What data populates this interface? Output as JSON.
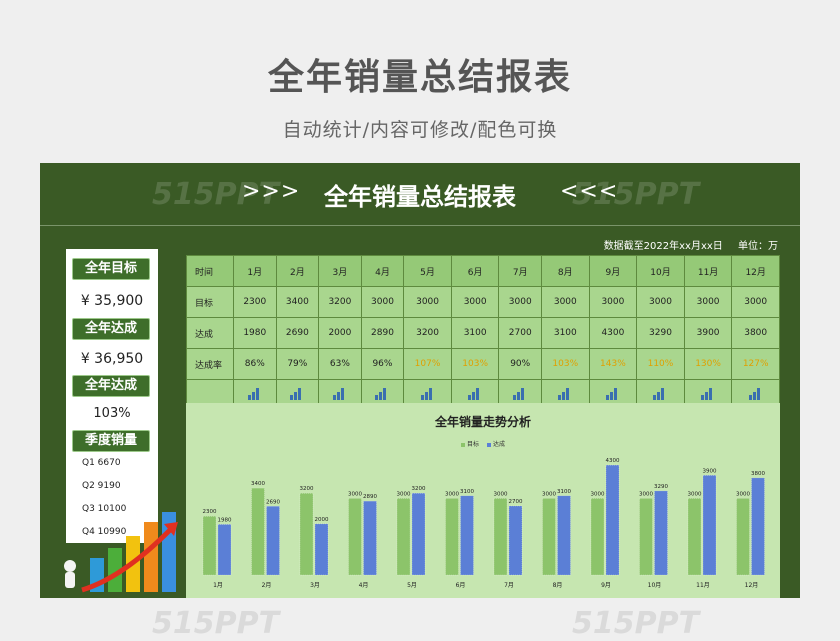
{
  "page": {
    "title": "全年销量总结报表",
    "subtitle": "自动统计/内容可修改/配色可换"
  },
  "header": {
    "title": "全年销量总结报表",
    "left_chevrons": ">>>",
    "right_chevrons": "<<<",
    "watermark": "515PPT"
  },
  "asof": {
    "date": "数据截至2022年xx月xx日",
    "unit": "单位：万"
  },
  "kpi": {
    "target_label": "全年目标",
    "target_value": "¥ 35,900",
    "achieved_label": "全年达成",
    "achieved_value": "¥ 36,950",
    "rate_label": "全年达成",
    "rate_value": "103%",
    "quarter_label": "季度销量",
    "quarters": [
      "Q1 6670",
      "Q2 9190",
      "Q3 10100",
      "Q4 10990"
    ]
  },
  "table": {
    "row_headers": [
      "时间",
      "目标",
      "达成",
      "达成率"
    ],
    "months": [
      "1月",
      "2月",
      "3月",
      "4月",
      "5月",
      "6月",
      "7月",
      "8月",
      "9月",
      "10月",
      "11月",
      "12月"
    ],
    "target": [
      "2300",
      "3400",
      "3200",
      "3000",
      "3000",
      "3000",
      "3000",
      "3000",
      "3000",
      "3000",
      "3000",
      "3000"
    ],
    "achieved": [
      "1980",
      "2690",
      "2000",
      "2890",
      "3200",
      "3100",
      "2700",
      "3100",
      "4300",
      "3290",
      "3900",
      "3800"
    ],
    "rate": [
      "86%",
      "79%",
      "63%",
      "96%",
      "107%",
      "103%",
      "90%",
      "103%",
      "143%",
      "110%",
      "130%",
      "127%"
    ]
  },
  "chart_data": {
    "type": "bar",
    "title": "全年销量走势分析",
    "categories": [
      "1月",
      "2月",
      "3月",
      "4月",
      "5月",
      "6月",
      "7月",
      "8月",
      "9月",
      "10月",
      "11月",
      "12月"
    ],
    "series": [
      {
        "name": "目标",
        "values": [
          2300,
          3400,
          3200,
          3000,
          3000,
          3000,
          3000,
          3000,
          3000,
          3000,
          3000,
          3000
        ]
      },
      {
        "name": "达成",
        "values": [
          1980,
          2690,
          2000,
          2890,
          3200,
          3100,
          2700,
          3100,
          4300,
          3290,
          3900,
          3800
        ]
      }
    ],
    "ylim": [
      0,
      4500
    ],
    "colors": {
      "target": "#8cc46a",
      "achieved": "#5b7fd6"
    }
  },
  "footer_watermark": "515PPT"
}
